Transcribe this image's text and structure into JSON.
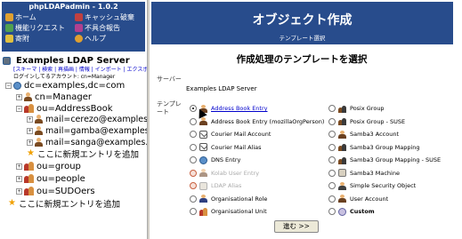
{
  "app": {
    "title": "phpLDAPadmin - 1.0.2"
  },
  "menu": {
    "home": "ホーム",
    "purge_caches": "キャッシュ破棄",
    "feature_request": "機能リクエスト",
    "report_bug": "不具合報告",
    "donate": "寄附",
    "help": "ヘルプ"
  },
  "server": {
    "name": "Examples LDAP Server",
    "links": "[スキーマ | 検索 | 再描画 | 情報 | インポート | エクスポート",
    "login": "ログインしてるアカウント: cn=Manager"
  },
  "tree": {
    "root": "dc=examples,dc=com",
    "manager": "cn=Manager",
    "addressbook": "ou=AddressBook",
    "mail1": "mail=cerezo@examples.c",
    "mail2": "mail=gamba@examples.c",
    "mail3": "mail=sanga@examples.c",
    "create_here": "ここに新規エントリを追加",
    "group": "ou=group",
    "people": "ou=people",
    "sudoers": "ou=SUDOers",
    "create_root": "ここに新規エントリを追加"
  },
  "main": {
    "banner_title": "オブジェクト作成",
    "banner_sub": "テンプレート選択",
    "heading": "作成処理のテンプレートを選択",
    "server_label": "サーバー",
    "server_value": "Examples LDAP Server",
    "template_label": "テンプレート",
    "next_button": "進む >>"
  },
  "templates_left": [
    {
      "label": "Address Book Entry",
      "icon": "person-icon",
      "state": "selected"
    },
    {
      "label": "Address Book Entry (mozillaOrgPerson)",
      "icon": "person-icon",
      "state": "normal"
    },
    {
      "label": "Courier Mail Account",
      "icon": "mail-icon",
      "state": "normal"
    },
    {
      "label": "Courier Mail Alias",
      "icon": "mail-icon",
      "state": "normal"
    },
    {
      "label": "DNS Entry",
      "icon": "dns-icon",
      "state": "normal"
    },
    {
      "label": "Kolab User Entry",
      "icon": "person-icon",
      "state": "disabled"
    },
    {
      "label": "LDAP Alias",
      "icon": "alias-icon",
      "state": "disabled"
    },
    {
      "label": "Organisational Role",
      "icon": "role-icon",
      "state": "normal"
    },
    {
      "label": "Organisational Unit",
      "icon": "ou-icon",
      "state": "normal"
    }
  ],
  "templates_right": [
    {
      "label": "Posix Group",
      "icon": "group-icon",
      "state": "normal"
    },
    {
      "label": "Posix Group - SUSE",
      "icon": "group-icon",
      "state": "normal"
    },
    {
      "label": "Samba3 Account",
      "icon": "person-icon",
      "state": "normal"
    },
    {
      "label": "Samba3 Group Mapping",
      "icon": "group-icon",
      "state": "normal"
    },
    {
      "label": "Samba3 Group Mapping - SUSE",
      "icon": "group-icon",
      "state": "normal"
    },
    {
      "label": "Samba3 Machine",
      "icon": "machine-icon",
      "state": "normal"
    },
    {
      "label": "Simple Security Object",
      "icon": "secure-icon",
      "state": "normal"
    },
    {
      "label": "User Account",
      "icon": "person-icon",
      "state": "normal"
    },
    {
      "label": "Custom",
      "icon": "custom-icon",
      "state": "bold"
    }
  ],
  "colors": {
    "header_blue": "#284c8c",
    "link_blue": "#0000cc"
  }
}
